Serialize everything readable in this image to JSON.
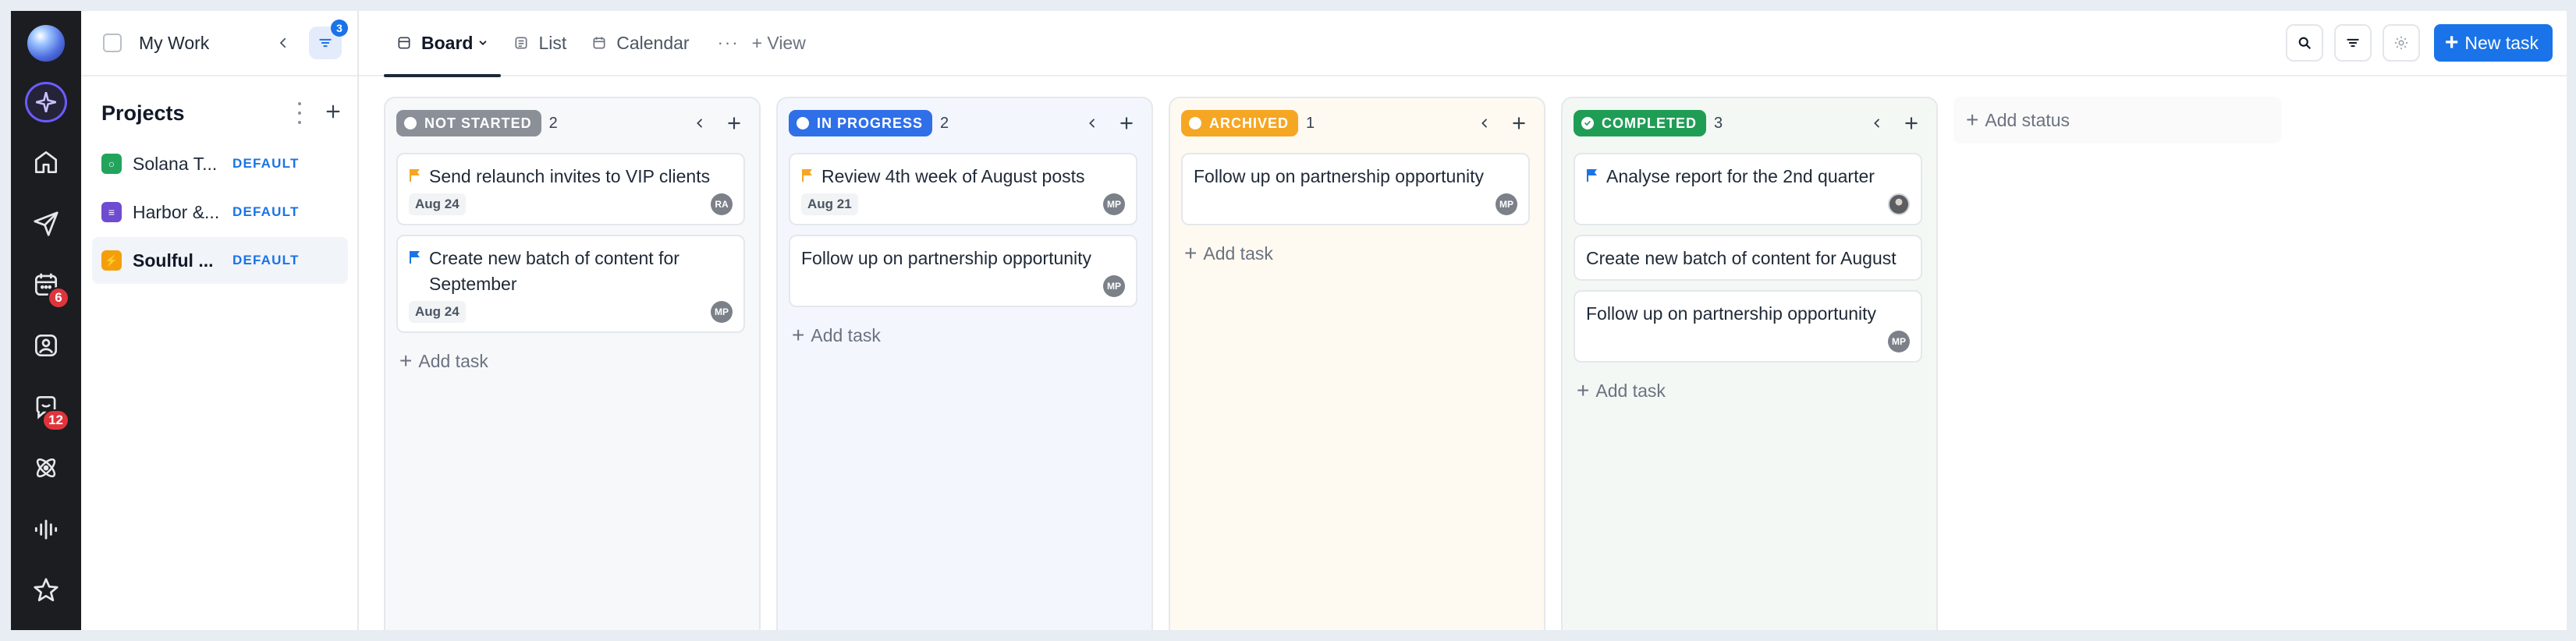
{
  "rail": {
    "badges": {
      "calendar": "6",
      "chat": "12"
    }
  },
  "sidebar": {
    "my_work_label": "My Work",
    "filter_badge": "3",
    "projects_title": "Projects",
    "projects": [
      {
        "name": "Solana T...",
        "tag": "DEFAULT",
        "color": "#22a45d",
        "glyph": "○"
      },
      {
        "name": "Harbor &...",
        "tag": "DEFAULT",
        "color": "#6e4bd1",
        "glyph": "≡"
      },
      {
        "name": "Soulful ...",
        "tag": "DEFAULT",
        "color": "#f59e0b",
        "glyph": "⚡"
      }
    ]
  },
  "topbar": {
    "tabs": [
      {
        "label": "Board",
        "icon": "board-icon"
      },
      {
        "label": "List",
        "icon": "list-icon"
      },
      {
        "label": "Calendar",
        "icon": "calendar-icon"
      }
    ],
    "more": "···",
    "add_view": "+ View",
    "new_task": "New task"
  },
  "board": {
    "add_task_label": "Add task",
    "add_status_label": "Add status",
    "columns": [
      {
        "status": "NOT STARTED",
        "count": "2",
        "pill_color": "#8a8f98",
        "bg": "#f7f8fa",
        "cards": [
          {
            "title": "Send relaunch invites to VIP clients",
            "flag": "#f5a623",
            "date": "Aug 24",
            "assignee": "RA"
          },
          {
            "title": "Create new batch of content for September",
            "flag": "#1a73e8",
            "date": "Aug 24",
            "assignee": "MP"
          }
        ]
      },
      {
        "status": "IN PROGRESS",
        "count": "2",
        "pill_color": "#2f6fe8",
        "bg": "#f3f6fd",
        "cards": [
          {
            "title": "Review 4th week of August posts",
            "flag": "#f5a623",
            "date": "Aug 21",
            "assignee": "MP"
          },
          {
            "title": "Follow up on partnership opportunity",
            "flag": "",
            "date": "",
            "assignee": "MP"
          }
        ]
      },
      {
        "status": "ARCHIVED",
        "count": "1",
        "pill_color": "#f5a623",
        "bg": "#fffaf1",
        "cards": [
          {
            "title": "Follow up on partnership opportunity",
            "flag": "",
            "date": "",
            "assignee": "MP"
          }
        ]
      },
      {
        "status": "COMPLETED",
        "count": "3",
        "pill_color": "#1f9d55",
        "bg": "#f3f8f4",
        "cards": [
          {
            "title": "Analyse report for the 2nd quarter",
            "flag": "#1a73e8",
            "date": "",
            "assignee": "photo"
          },
          {
            "title": "Create new batch of content for August",
            "flag": "",
            "date": "",
            "assignee": ""
          },
          {
            "title": "Follow up on partnership opportunity",
            "flag": "",
            "date": "",
            "assignee": "MP"
          }
        ]
      }
    ]
  }
}
